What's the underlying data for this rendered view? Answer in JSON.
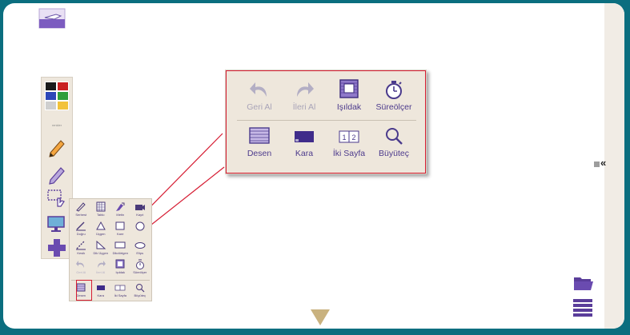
{
  "palette_label": "renkler",
  "palette_colors": [
    "#1a1a1a",
    "#c92020",
    "#2d47b8",
    "#2f9e3b",
    "#cfcfcf",
    "#f2c23a"
  ],
  "small_panel": {
    "row1": [
      "Serbest",
      "Tablo",
      "Metin",
      "Kayıt"
    ],
    "row2": [
      "Doğru",
      "Üçgen",
      "Kare",
      ""
    ],
    "row3": [
      "Kesik",
      "Dik Üçgen",
      "Dikdörtgen",
      "Elips"
    ],
    "row4": [
      "Geri Al",
      "İleri Al",
      "Işıldak",
      "Süreölçer"
    ],
    "bottom": [
      "Desen",
      "Kara",
      "İki Sayfa",
      "Büyüteç"
    ]
  },
  "zoom_panel": {
    "top": [
      "Geri Al",
      "İleri Al",
      "Işıldak",
      "Süreölçer"
    ],
    "bottom": [
      "Desen",
      "Kara",
      "İki Sayfa",
      "Büyüteç"
    ],
    "two_page_numbers": [
      "1",
      "2"
    ]
  },
  "accent_color": "#5a3d9a",
  "highlight_color": "#d61d33"
}
